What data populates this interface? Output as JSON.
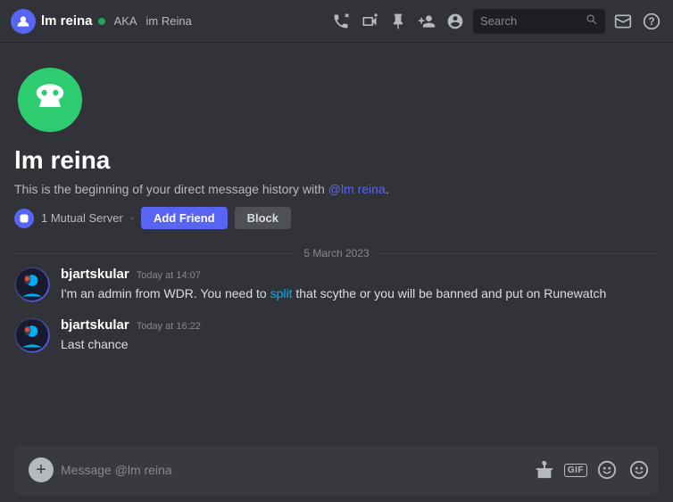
{
  "topbar": {
    "username": "lm reina",
    "aka_label": "AKA",
    "aka_name": "im Reina",
    "search_placeholder": "Search"
  },
  "profile": {
    "name": "lm reina",
    "dm_history": "This is the beginning of your direct message history with ",
    "mention": "@lm reina",
    "dm_history_end": ".",
    "mutual_server_text": "1 Mutual Server",
    "add_friend_label": "Add Friend",
    "block_label": "Block"
  },
  "date_divider": {
    "text": "5 March 2023"
  },
  "messages": [
    {
      "username": "bjartskular",
      "time": "Today at 14:07",
      "text_before": "I'm an admin from WDR. You need to ",
      "highlight": "split",
      "text_after": " that scythe or you will be banned and put on Runewatch"
    },
    {
      "username": "bjartskular",
      "time": "Today at 16:22",
      "text": "Last chance"
    }
  ],
  "input": {
    "placeholder": "Message @lm reina"
  },
  "icons": {
    "phone": "📞",
    "video": "📹",
    "pin": "📌",
    "add_user": "👤",
    "profile": "👤",
    "search": "🔍",
    "inbox": "📥",
    "help": "❓"
  }
}
